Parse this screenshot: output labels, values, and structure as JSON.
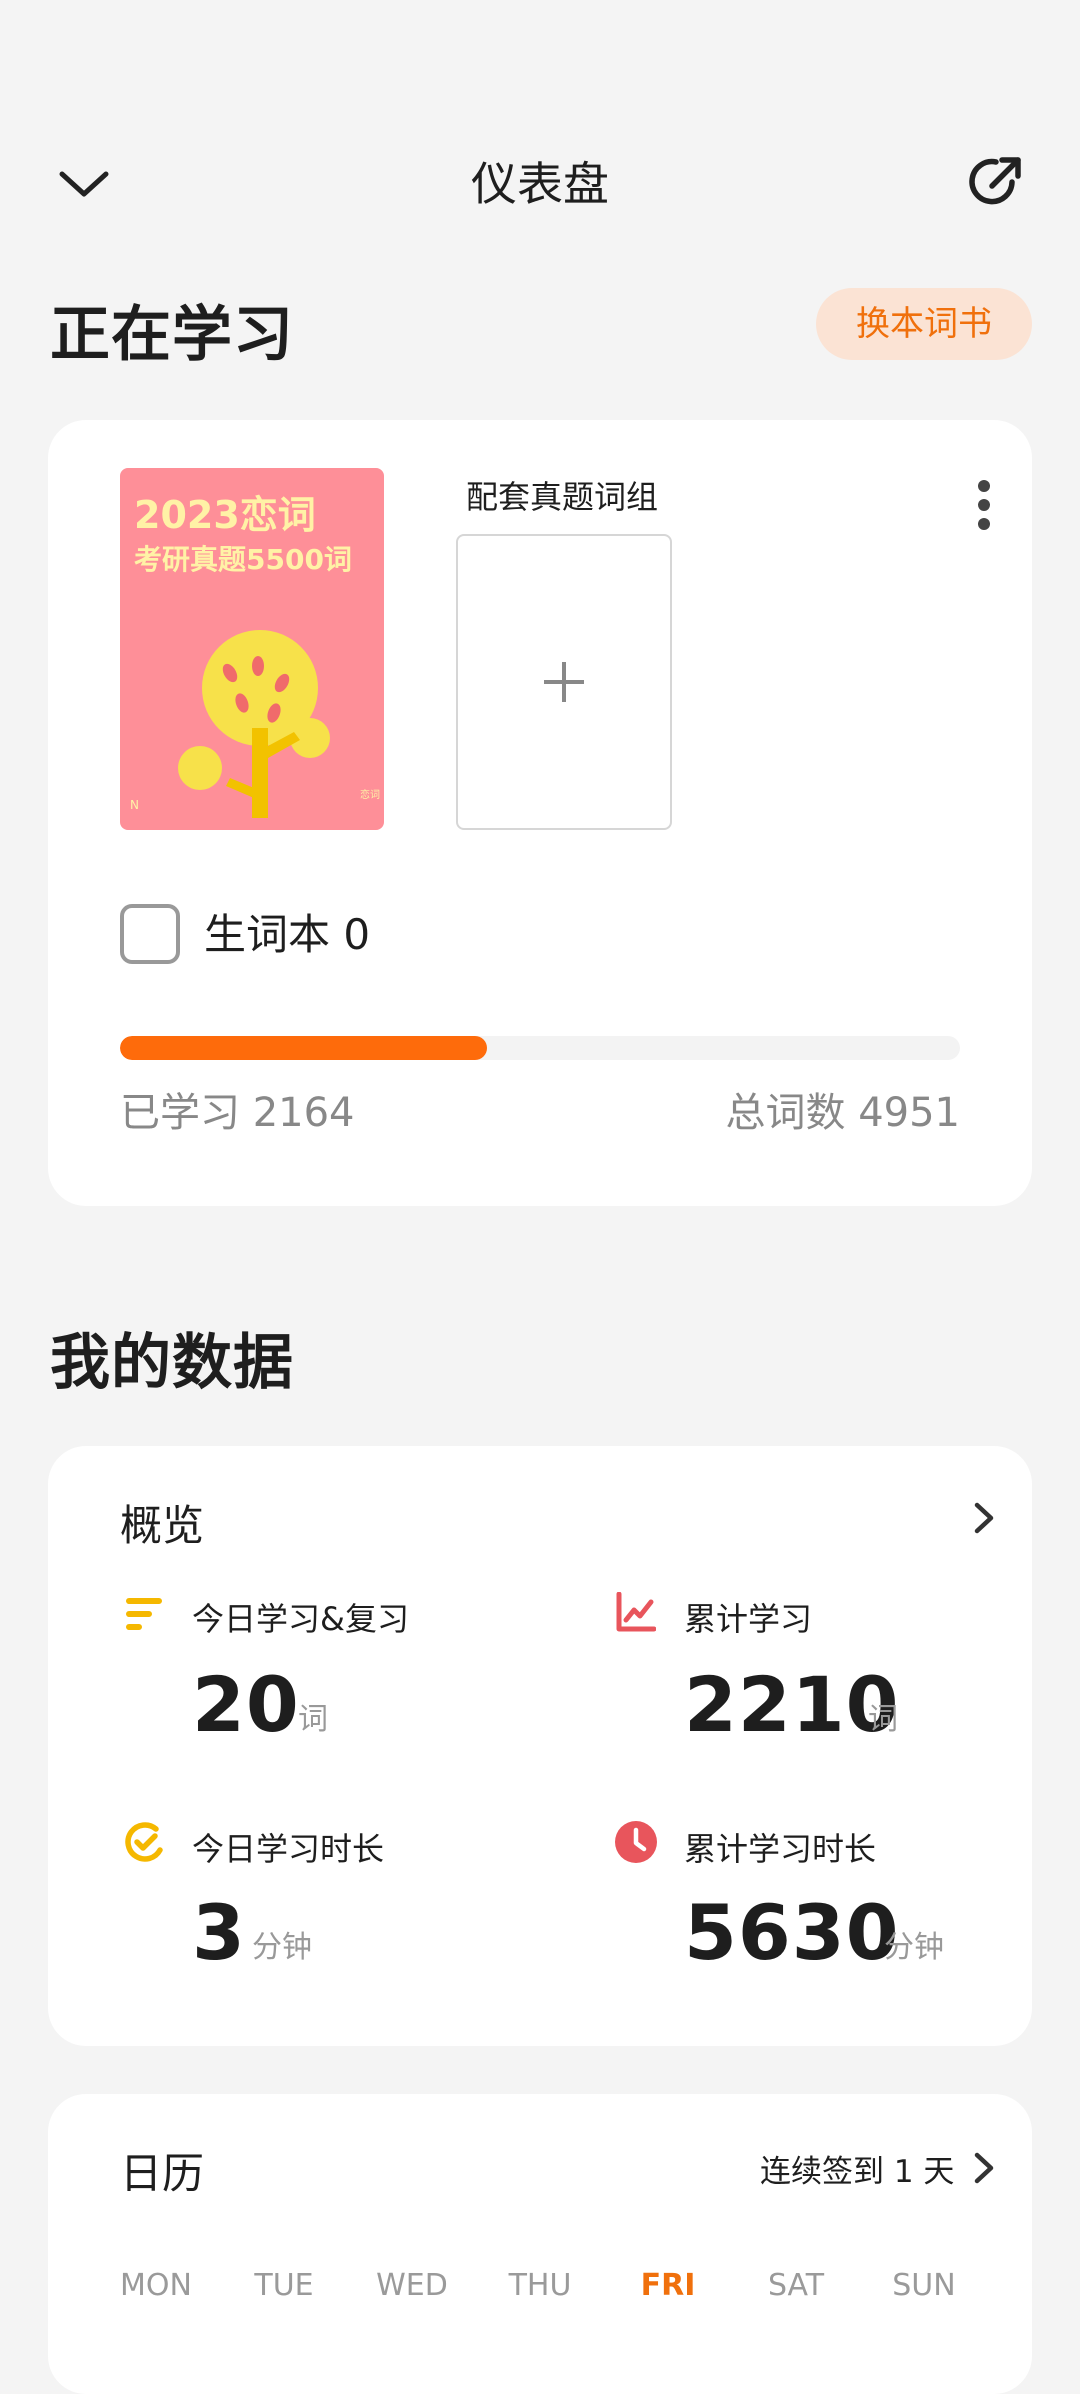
{
  "header": {
    "title": "仪表盘",
    "back_icon": "chevron-down-icon",
    "share_icon": "external-link-icon"
  },
  "studying": {
    "section_title": "正在学习",
    "switch_button": "换本词书",
    "book": {
      "cover_line1": "2023恋词",
      "cover_line2": "考研真题5500词",
      "cover_corner_left": "N",
      "cover_corner_right": "恋词"
    },
    "group_label": "配套真题词组",
    "add_icon": "plus-icon",
    "more_icon": "more-vertical-icon",
    "wordbook_label": "生词本 0",
    "progress": {
      "learned": 2164,
      "total": 4951,
      "fraction": 0.437
    },
    "learned_text": "已学习 2164",
    "total_text": "总词数 4951",
    "accent": "#fe6b0b"
  },
  "my_data": {
    "section_title": "我的数据",
    "overview": {
      "title": "概览",
      "stats": [
        {
          "label": "今日学习&复习",
          "value": "20",
          "unit": "词",
          "icon": "bars-icon",
          "color": "#f5b800"
        },
        {
          "label": "累计学习",
          "value": "2210",
          "unit": "词",
          "icon": "trend-chart-icon",
          "color": "#e8555c"
        },
        {
          "label": "今日学习时长",
          "value": "3",
          "unit": "分钟",
          "icon": "timer-icon",
          "color": "#f5b800"
        },
        {
          "label": "累计学习时长",
          "value": "5630",
          "unit": "分钟",
          "icon": "clock-icon",
          "color": "#e8555c"
        }
      ]
    },
    "calendar": {
      "title": "日历",
      "streak": "连续签到 1 天",
      "weekdays": [
        "MON",
        "TUE",
        "WED",
        "THU",
        "FRI",
        "SAT",
        "SUN"
      ],
      "active_day": "FRI"
    }
  }
}
